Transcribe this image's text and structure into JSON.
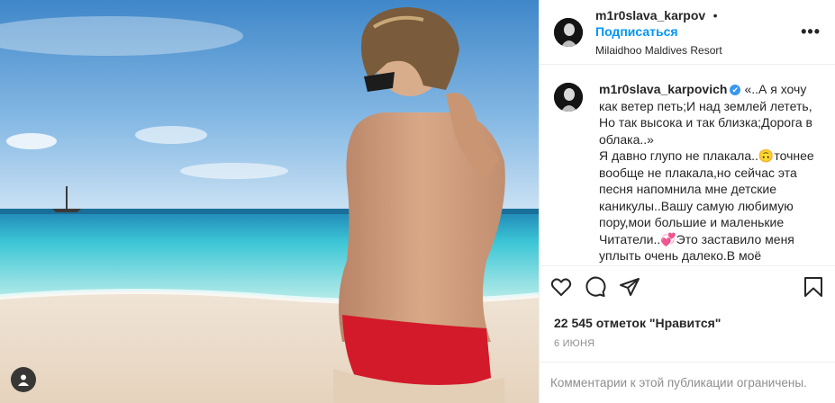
{
  "post": {
    "username": "m1r0slava_karpov",
    "dot": "•",
    "follow_label": "Подписаться",
    "location": "Milaidhoo Maldives Resort",
    "more_label": "•••"
  },
  "caption": {
    "username": "m1r0slava_karpovich",
    "verified_mark": "✔",
    "text": "«..А я хочу как ветер петь;И над землей лететь,\nНо так высока и так близка;Дорога в облака..»\nЯ давно глупо не плакала..🙃точнее вообще не плакала,но сейчас эта песня напомнила мне детские каникулы..Вашу самую любимую пору,мои большие и маленькие Читатели..💞Это заставило меня уплыть очень далеко.В моё"
  },
  "actions": {
    "like": "heart-icon",
    "comment": "comment-icon",
    "share": "share-icon",
    "save": "bookmark-icon"
  },
  "likes_text": "22 545 отметок \"Нравится\"",
  "date_text": "6 ИЮНЯ",
  "comments_notice": "Комментарии к этой публикации ограничены.",
  "colors": {
    "accent": "#0095f6",
    "verified": "#3897f0",
    "text": "#262626",
    "muted": "#8e8e8e",
    "border": "#efefef"
  }
}
